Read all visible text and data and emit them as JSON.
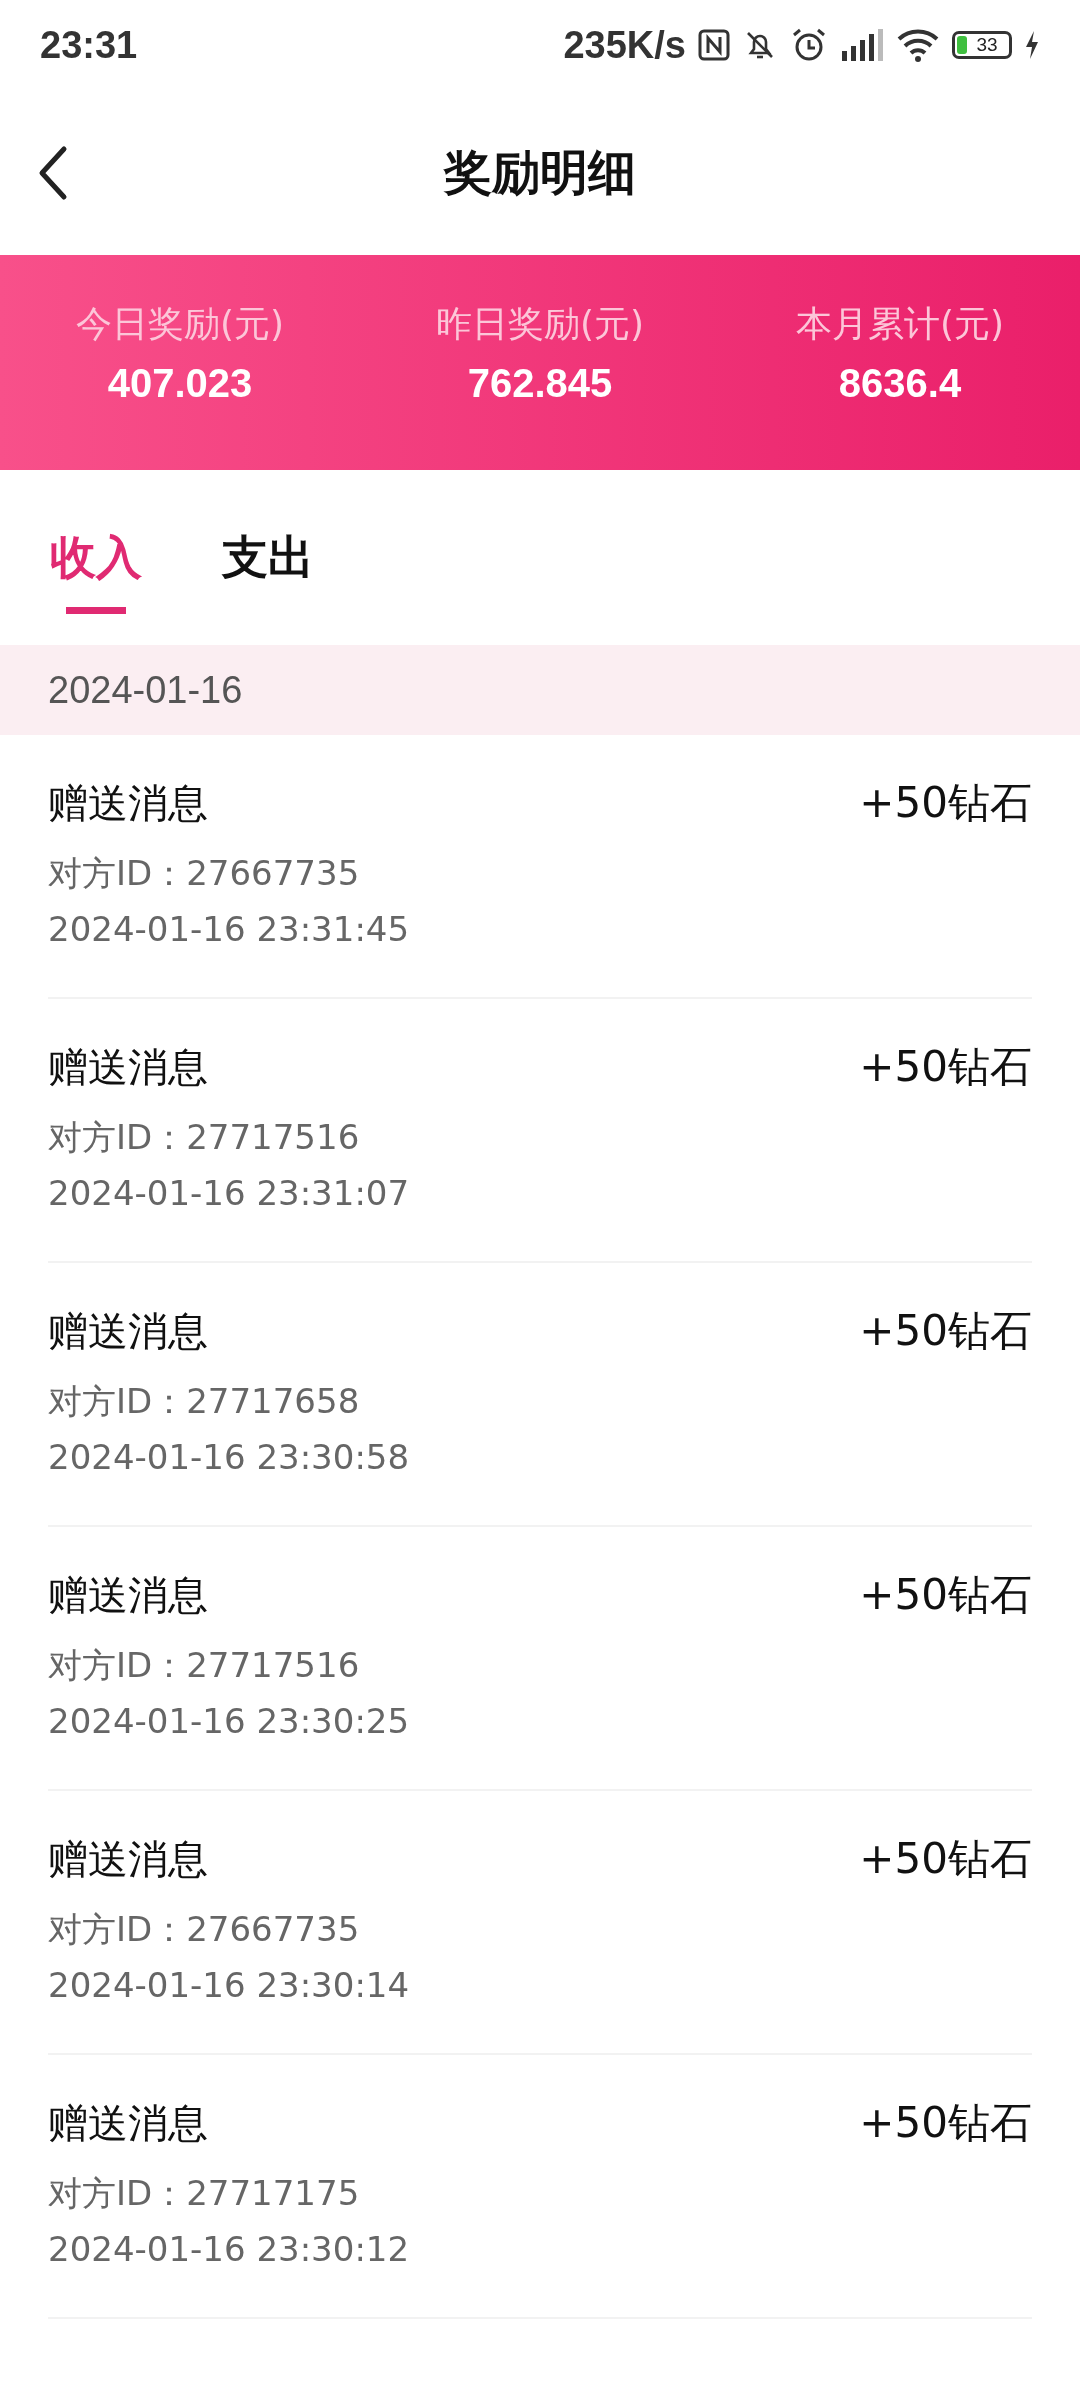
{
  "status_bar": {
    "time": "23:31",
    "net_speed": "235K/s",
    "battery": "33"
  },
  "header": {
    "title": "奖励明细"
  },
  "summary": [
    {
      "label": "今日奖励(元)",
      "value": "407.023"
    },
    {
      "label": "昨日奖励(元)",
      "value": "762.845"
    },
    {
      "label": "本月累计(元)",
      "value": "8636.4"
    }
  ],
  "tabs": [
    {
      "label": "收入",
      "selected": true
    },
    {
      "label": "支出",
      "selected": false
    }
  ],
  "date_header": "2024-01-16",
  "records": [
    {
      "title": "赠送消息",
      "amount": "+50钻石",
      "partner": "对方ID：27667735",
      "time": "2024-01-16 23:31:45"
    },
    {
      "title": "赠送消息",
      "amount": "+50钻石",
      "partner": "对方ID：27717516",
      "time": "2024-01-16 23:31:07"
    },
    {
      "title": "赠送消息",
      "amount": "+50钻石",
      "partner": "对方ID：27717658",
      "time": "2024-01-16 23:30:58"
    },
    {
      "title": "赠送消息",
      "amount": "+50钻石",
      "partner": "对方ID：27717516",
      "time": "2024-01-16 23:30:25"
    },
    {
      "title": "赠送消息",
      "amount": "+50钻石",
      "partner": "对方ID：27667735",
      "time": "2024-01-16 23:30:14"
    },
    {
      "title": "赠送消息",
      "amount": "+50钻石",
      "partner": "对方ID：27717175",
      "time": "2024-01-16 23:30:12"
    }
  ]
}
